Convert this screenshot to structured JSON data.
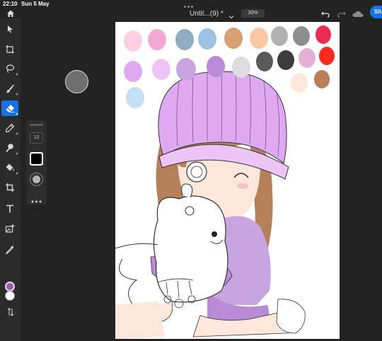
{
  "status_bar": {
    "time": "22:10",
    "date": "Sun 5 May"
  },
  "document": {
    "title": "Untit...(9) *",
    "zoom": "30%"
  },
  "share_label": "Sh",
  "tool_options": {
    "size": "10"
  },
  "colors": {
    "primary": "#9b59b6",
    "secondary": "#ffffff",
    "accent": "#1473e6",
    "palette": [
      "#fcd0e0",
      "#f3a7d4",
      "#91abc5",
      "#9cc3e2",
      "#d79f72",
      "#fcc8a3",
      "#b2b1b1",
      "#8e8e8e",
      "#ea2c53",
      "#dfa9f2",
      "#ecc4f6",
      "#c8a4e0",
      "#b98ad6",
      "#dcdde1",
      "#595959",
      "#3b3b3b",
      "#e3b0d6",
      "#ff2b1c",
      "#c5dff5",
      "#fde6da",
      "#b5805a"
    ]
  },
  "icons": {
    "home": "home-icon",
    "undo": "undo-icon",
    "redo": "redo-icon",
    "cloud": "cloud-icon",
    "tools": [
      "move-tool-icon",
      "transform-tool-icon",
      "lasso-tool-icon",
      "brush-tool-icon",
      "eraser-tool-icon",
      "pencil-tool-icon",
      "blur-tool-icon",
      "fill-tool-icon",
      "crop-tool-icon",
      "text-tool-icon",
      "image-tool-icon",
      "eyedropper-tool-icon",
      "swap-colors-icon"
    ]
  }
}
